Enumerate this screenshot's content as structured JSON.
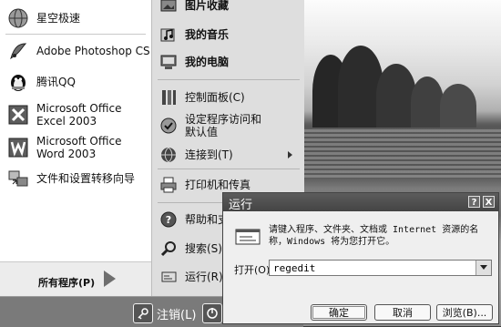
{
  "start_menu": {
    "pinned": [
      {
        "label": "星空极速",
        "icon": "globe-icon"
      },
      {
        "label": "Adobe Photoshop CS",
        "icon": "photoshop-icon"
      },
      {
        "label": "腾讯QQ",
        "icon": "qq-penguin-icon"
      },
      {
        "label": "Microsoft Office Excel 2003",
        "icon": "excel-icon"
      },
      {
        "label": "Microsoft Office Word 2003",
        "icon": "word-icon"
      },
      {
        "label": "文件和设置转移向导",
        "icon": "transfer-wizard-icon"
      }
    ],
    "all_programs": "所有程序(P)",
    "right": [
      {
        "label": "图片收藏",
        "icon": "pictures-icon"
      },
      {
        "label": "我的音乐",
        "icon": "music-icon"
      },
      {
        "label": "我的电脑",
        "icon": "computer-icon"
      },
      {
        "label": "控制面板(C)",
        "icon": "control-panel-icon"
      },
      {
        "label": "设定程序访问和默认值",
        "icon": "program-access-icon"
      },
      {
        "label": "连接到(T)",
        "icon": "connect-icon"
      },
      {
        "label": "打印机和传真",
        "icon": "printer-icon"
      },
      {
        "label": "帮助和支",
        "icon": "help-icon"
      },
      {
        "label": "搜索(S)",
        "icon": "search-icon"
      },
      {
        "label": "运行(R)",
        "icon": "run-icon"
      }
    ],
    "logoff": "注销(L)",
    "shutdown_icon": "power-icon"
  },
  "run_dialog": {
    "title": "运行",
    "help_btn": "?",
    "close_btn": "X",
    "description": "请键入程序、文件夹、文档或 Internet 资源的名称，Windows 将为您打开它。",
    "open_label": "打开(O):",
    "open_value": "regedit",
    "buttons": {
      "ok": "确定",
      "cancel": "取消",
      "browse": "浏览(B)..."
    }
  }
}
